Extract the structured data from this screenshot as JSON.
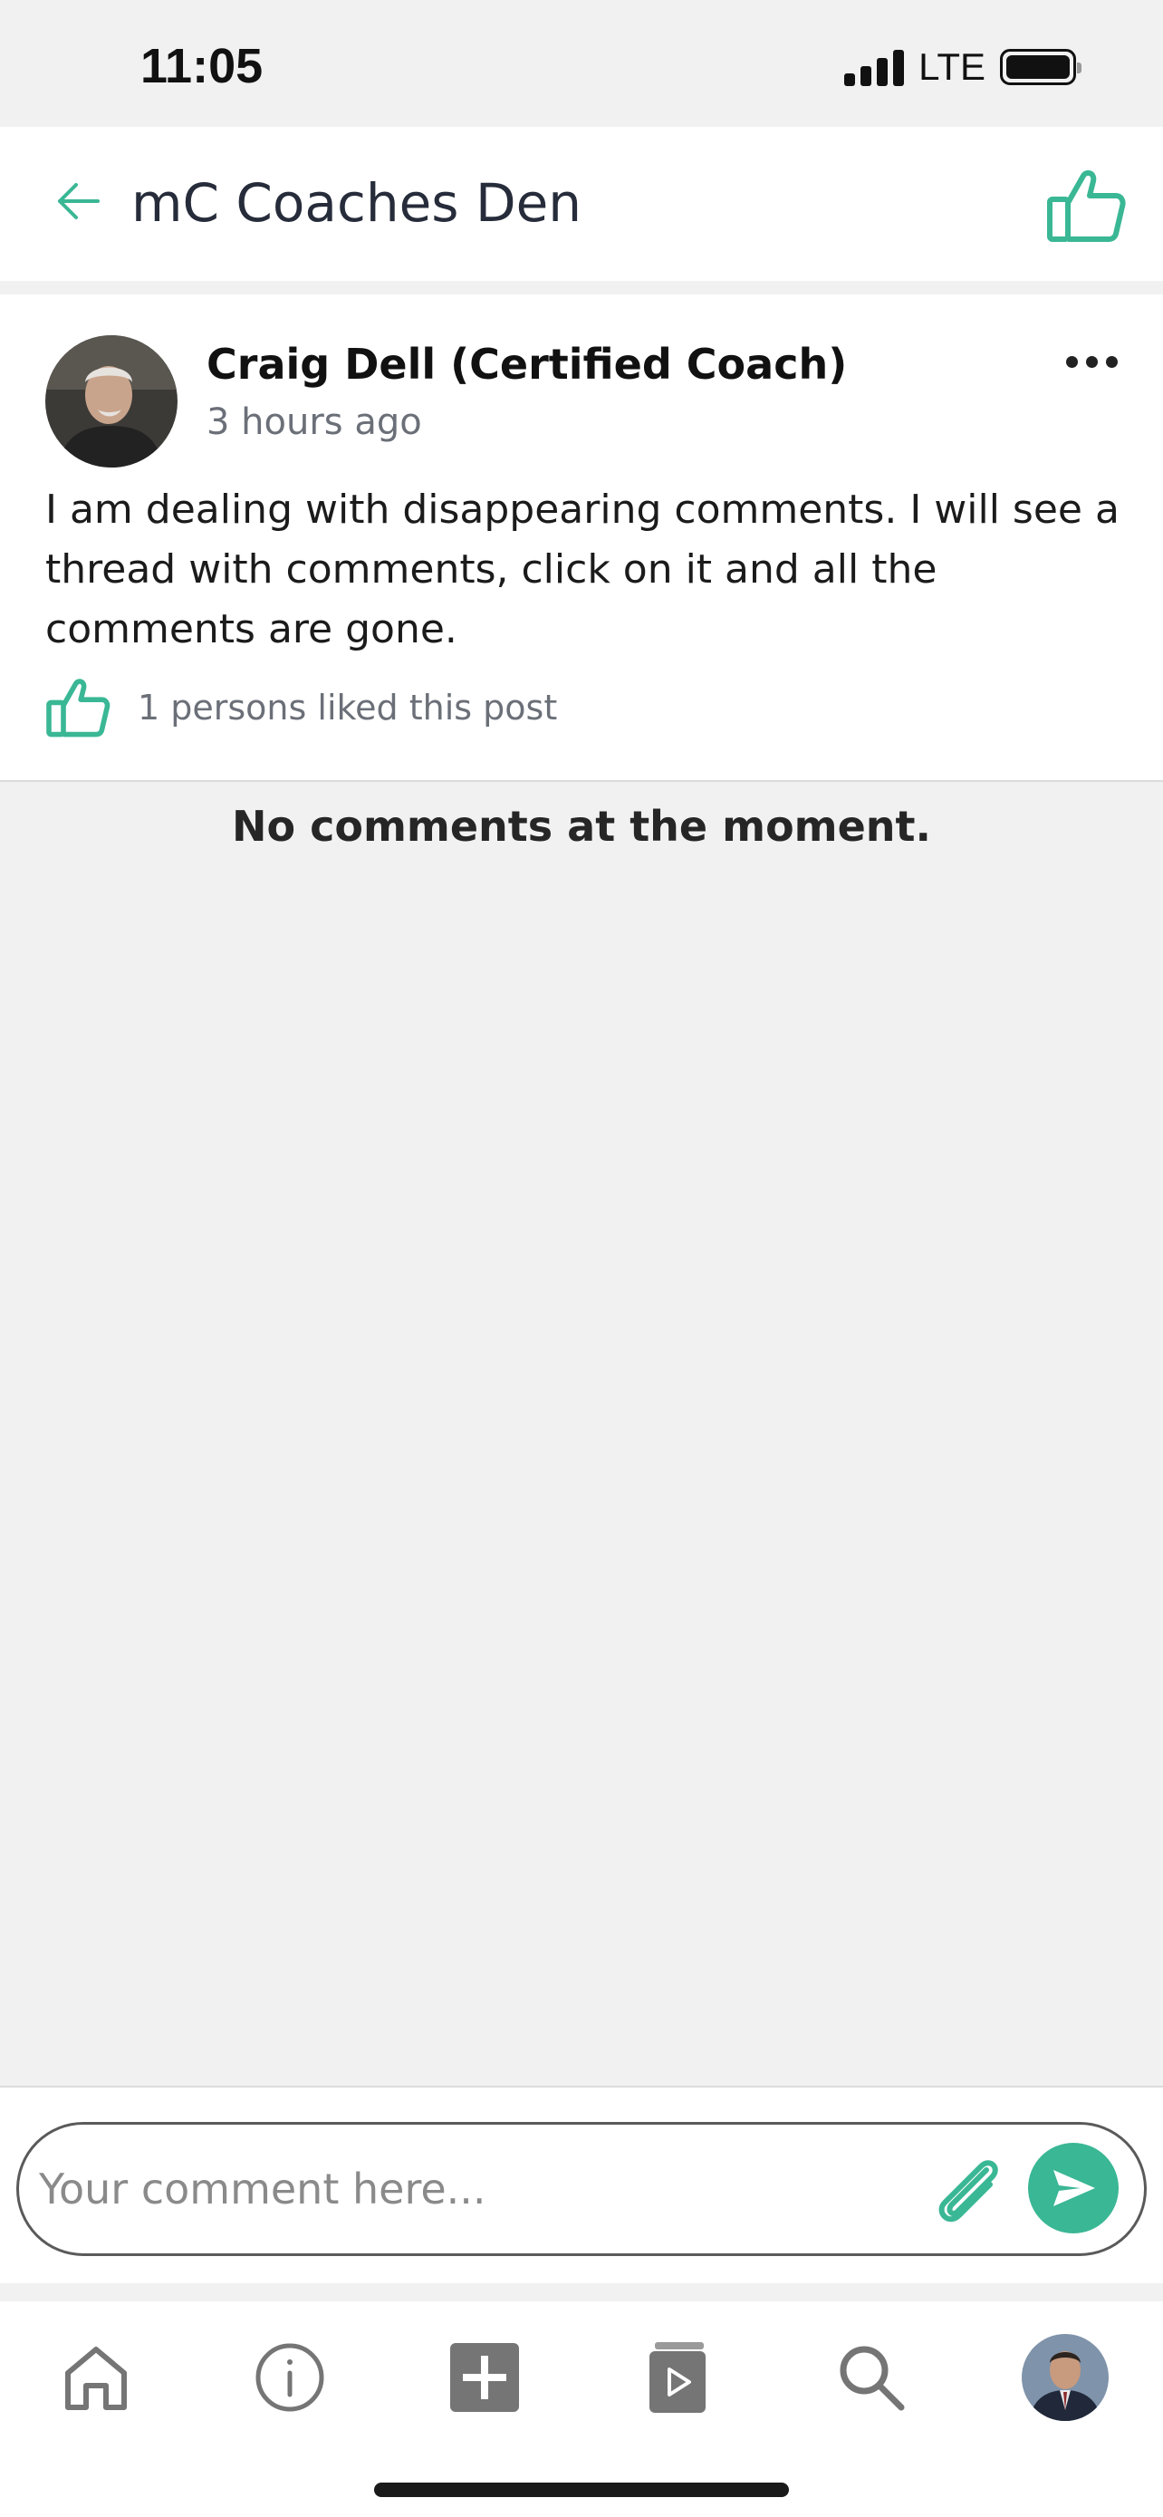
{
  "status_bar": {
    "time": "11:05",
    "network": "LTE"
  },
  "header": {
    "title": "mC Coaches Den"
  },
  "post": {
    "author": "Craig Dell (Certified Coach)",
    "time": "3 hours ago",
    "body": "I am dealing with disappearing comments. I will see a thread with comments, click on it and all the comments are gone.",
    "likes_text": "1 persons liked this post"
  },
  "comments": {
    "empty_text": "No comments at the moment."
  },
  "composer": {
    "placeholder": "Your comment here..."
  },
  "tabs": [
    "home-icon",
    "info-icon",
    "add-icon",
    "video-library-icon",
    "search-icon",
    "profile-avatar"
  ],
  "colors": {
    "accent": "#3ab795",
    "background": "#f1f1f1"
  }
}
